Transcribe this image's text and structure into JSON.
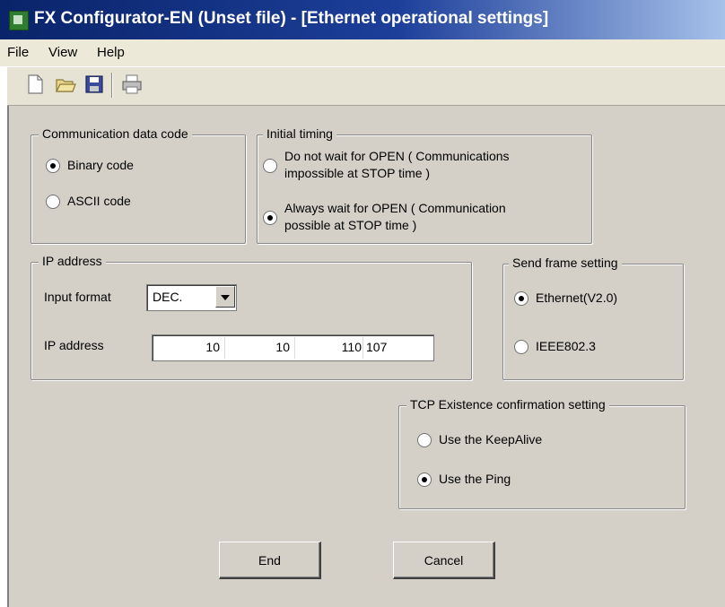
{
  "window": {
    "title": "FX Configurator-EN (Unset file) - [Ethernet operational settings]"
  },
  "menu": {
    "file": "File",
    "view": "View",
    "help": "Help"
  },
  "toolbar": {
    "icons": [
      "new-file-icon",
      "open-folder-icon",
      "save-disk-icon",
      "print-icon"
    ]
  },
  "communication_data_code": {
    "title": "Communication data code",
    "options": [
      {
        "label": "Binary code",
        "checked": true
      },
      {
        "label": "ASCII code",
        "checked": false
      }
    ]
  },
  "initial_timing": {
    "title": "Initial timing",
    "options": [
      {
        "line1": "Do not wait for OPEN ( Communications",
        "line2": "impossible at STOP time )",
        "checked": false
      },
      {
        "line1": "Always wait for OPEN ( Communication",
        "line2": "possible at STOP time )",
        "checked": true
      }
    ]
  },
  "ip_address_group": {
    "title": "IP address",
    "input_format_label": "Input format",
    "input_format_value": "DEC.",
    "ip_label": "IP address",
    "octets": [
      "10",
      "10",
      "110",
      "107"
    ]
  },
  "send_frame": {
    "title": "Send frame setting",
    "options": [
      {
        "label": "Ethernet(V2.0)",
        "checked": true
      },
      {
        "label": "IEEE802.3",
        "checked": false
      }
    ]
  },
  "tcp_existence": {
    "title": "TCP Existence confirmation setting",
    "options": [
      {
        "label": "Use the KeepAlive",
        "checked": false
      },
      {
        "label": "Use the Ping",
        "checked": true
      }
    ]
  },
  "buttons": {
    "end": "End",
    "cancel": "Cancel"
  }
}
